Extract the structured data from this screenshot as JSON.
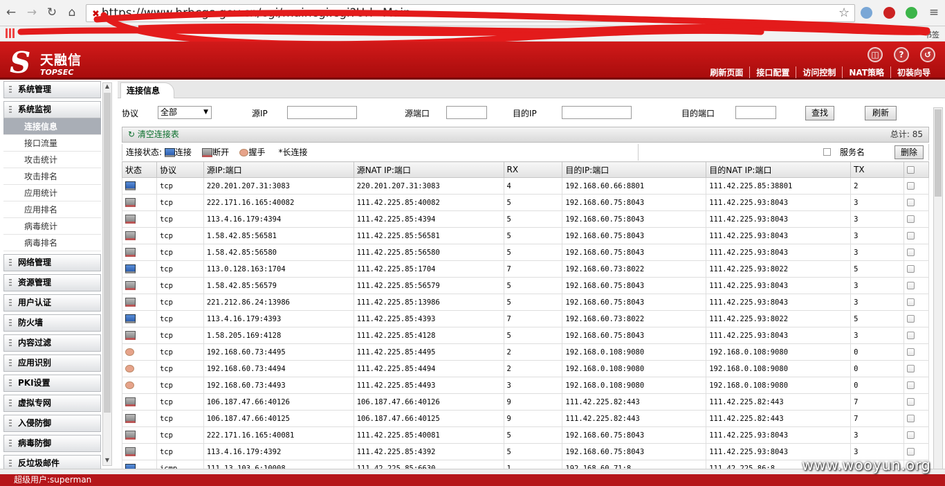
{
  "browser": {
    "url": "https://www.hrbcgs.gov.cn/cgi/maincgi.cgi?Url=Main",
    "bookmarks_right": "书签"
  },
  "header": {
    "logo_cn": "天融信",
    "logo_en": "TOPSEC",
    "nav": [
      "刷新页面",
      "接口配置",
      "访问控制",
      "NAT策略",
      "初装向导"
    ]
  },
  "sidebar": {
    "categories_top": [
      "系统管理",
      "系统监视"
    ],
    "sub_items": [
      "连接信息",
      "接口流量",
      "攻击统计",
      "攻击排名",
      "应用统计",
      "应用排名",
      "病毒统计",
      "病毒排名"
    ],
    "categories_bottom": [
      "网络管理",
      "资源管理",
      "用户认证",
      "防火墙",
      "内容过滤",
      "应用识别",
      "PKI设置",
      "虚拟专网",
      "入侵防御",
      "病毒防御",
      "反垃圾邮件"
    ]
  },
  "main": {
    "tab": "连接信息",
    "filters": {
      "protocol_label": "协议",
      "protocol_value": "全部",
      "src_ip_label": "源IP",
      "src_port_label": "源端口",
      "dst_ip_label": "目的IP",
      "dst_port_label": "目的端口",
      "search_button": "查找",
      "refresh_button": "刷新"
    },
    "clear_label": "清空连接表",
    "total": "总计: 85",
    "status_legend": {
      "label": "连接状态:",
      "connect": "连接",
      "disconnect": "断开",
      "handshake": "握手",
      "long": "*长连接"
    },
    "service_name_label": "服务名",
    "delete_button": "删除",
    "columns": [
      "状态",
      "协议",
      "源IP:端口",
      "源NAT IP:端口",
      "RX",
      "目的IP:端口",
      "目的NAT IP:端口",
      "TX"
    ],
    "rows": [
      {
        "status": "connect",
        "proto": "tcp",
        "src": "220.201.207.31:3083",
        "snat": "220.201.207.31:3083",
        "rx": "4",
        "dst": "192.168.60.66:8801",
        "dnat": "111.42.225.85:38801",
        "tx": "2"
      },
      {
        "status": "disconnect",
        "proto": "tcp",
        "src": "222.171.16.165:40082",
        "snat": "111.42.225.85:40082",
        "rx": "5",
        "dst": "192.168.60.75:8043",
        "dnat": "111.42.225.93:8043",
        "tx": "3"
      },
      {
        "status": "disconnect",
        "proto": "tcp",
        "src": "113.4.16.179:4394",
        "snat": "111.42.225.85:4394",
        "rx": "5",
        "dst": "192.168.60.75:8043",
        "dnat": "111.42.225.93:8043",
        "tx": "3"
      },
      {
        "status": "disconnect",
        "proto": "tcp",
        "src": "1.58.42.85:56581",
        "snat": "111.42.225.85:56581",
        "rx": "5",
        "dst": "192.168.60.75:8043",
        "dnat": "111.42.225.93:8043",
        "tx": "3"
      },
      {
        "status": "disconnect",
        "proto": "tcp",
        "src": "1.58.42.85:56580",
        "snat": "111.42.225.85:56580",
        "rx": "5",
        "dst": "192.168.60.75:8043",
        "dnat": "111.42.225.93:8043",
        "tx": "3"
      },
      {
        "status": "connect",
        "proto": "tcp",
        "src": "113.0.128.163:1704",
        "snat": "111.42.225.85:1704",
        "rx": "7",
        "dst": "192.168.60.73:8022",
        "dnat": "111.42.225.93:8022",
        "tx": "5"
      },
      {
        "status": "disconnect",
        "proto": "tcp",
        "src": "1.58.42.85:56579",
        "snat": "111.42.225.85:56579",
        "rx": "5",
        "dst": "192.168.60.75:8043",
        "dnat": "111.42.225.93:8043",
        "tx": "3"
      },
      {
        "status": "disconnect",
        "proto": "tcp",
        "src": "221.212.86.24:13986",
        "snat": "111.42.225.85:13986",
        "rx": "5",
        "dst": "192.168.60.75:8043",
        "dnat": "111.42.225.93:8043",
        "tx": "3"
      },
      {
        "status": "connect",
        "proto": "tcp",
        "src": "113.4.16.179:4393",
        "snat": "111.42.225.85:4393",
        "rx": "7",
        "dst": "192.168.60.73:8022",
        "dnat": "111.42.225.93:8022",
        "tx": "5"
      },
      {
        "status": "disconnect",
        "proto": "tcp",
        "src": "1.58.205.169:4128",
        "snat": "111.42.225.85:4128",
        "rx": "5",
        "dst": "192.168.60.75:8043",
        "dnat": "111.42.225.93:8043",
        "tx": "3"
      },
      {
        "status": "handshake",
        "proto": "tcp",
        "src": "192.168.60.73:4495",
        "snat": "111.42.225.85:4495",
        "rx": "2",
        "dst": "192.168.0.108:9080",
        "dnat": "192.168.0.108:9080",
        "tx": "0"
      },
      {
        "status": "handshake",
        "proto": "tcp",
        "src": "192.168.60.73:4494",
        "snat": "111.42.225.85:4494",
        "rx": "2",
        "dst": "192.168.0.108:9080",
        "dnat": "192.168.0.108:9080",
        "tx": "0"
      },
      {
        "status": "handshake",
        "proto": "tcp",
        "src": "192.168.60.73:4493",
        "snat": "111.42.225.85:4493",
        "rx": "3",
        "dst": "192.168.0.108:9080",
        "dnat": "192.168.0.108:9080",
        "tx": "0"
      },
      {
        "status": "disconnect",
        "proto": "tcp",
        "src": "106.187.47.66:40126",
        "snat": "106.187.47.66:40126",
        "rx": "9",
        "dst": "111.42.225.82:443",
        "dnat": "111.42.225.82:443",
        "tx": "7"
      },
      {
        "status": "disconnect",
        "proto": "tcp",
        "src": "106.187.47.66:40125",
        "snat": "106.187.47.66:40125",
        "rx": "9",
        "dst": "111.42.225.82:443",
        "dnat": "111.42.225.82:443",
        "tx": "7"
      },
      {
        "status": "disconnect",
        "proto": "tcp",
        "src": "222.171.16.165:40081",
        "snat": "111.42.225.85:40081",
        "rx": "5",
        "dst": "192.168.60.75:8043",
        "dnat": "111.42.225.93:8043",
        "tx": "3"
      },
      {
        "status": "disconnect",
        "proto": "tcp",
        "src": "113.4.16.179:4392",
        "snat": "111.42.225.85:4392",
        "rx": "5",
        "dst": "192.168.60.75:8043",
        "dnat": "111.42.225.93:8043",
        "tx": "3"
      },
      {
        "status": "connect",
        "proto": "icmp",
        "src": "111.13.103.6:10008",
        "snat": "111.42.225.85:6630",
        "rx": "1",
        "dst": "192.168.60.71:8",
        "dnat": "111.42.225.86:8",
        "tx": ""
      }
    ]
  },
  "footer": {
    "user": "超级用户:superman"
  },
  "watermark": "www.wooyun.org"
}
